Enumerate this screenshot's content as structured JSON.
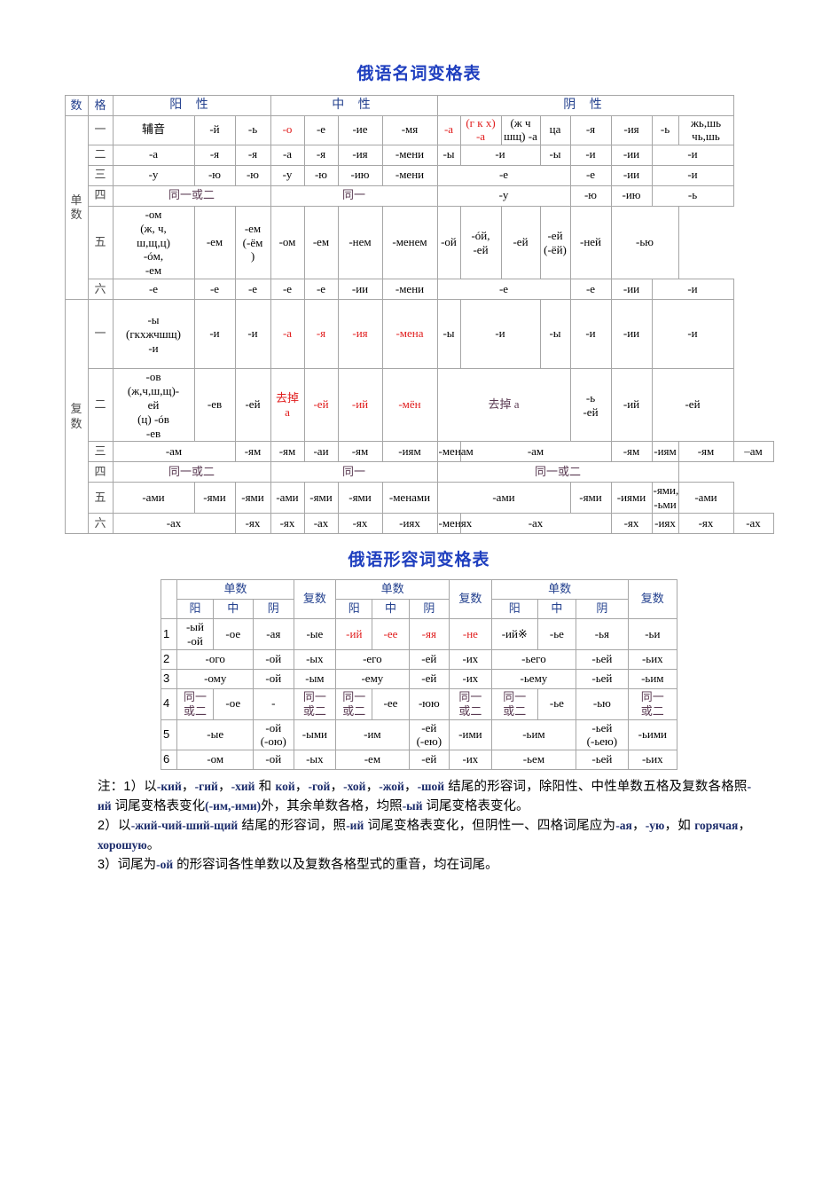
{
  "noun_table": {
    "title": "俄语名词变格表",
    "header": {
      "number_label": "数",
      "case_label": "格",
      "masculine": "阳 性",
      "neuter": "中 性",
      "feminine": "阴 性"
    },
    "number_groups": {
      "singular": [
        "单",
        "数"
      ],
      "plural": [
        "复",
        "数"
      ]
    },
    "singular_rows": [
      {
        "case": "一",
        "cells": [
          {
            "t": "辅音",
            "cn": true
          },
          {
            "t": "-й"
          },
          {
            "t": "-ь"
          },
          {
            "t": "-о",
            "red": true
          },
          {
            "t": "-е"
          },
          {
            "t": "-ие"
          },
          {
            "t": "-мя"
          },
          {
            "t": "-а",
            "red": true
          },
          {
            "t": "(г к х) -а",
            "red": true
          },
          {
            "t": "(ж ч шщ) -а"
          },
          {
            "t": "ца"
          },
          {
            "t": "-я"
          },
          {
            "t": "-ия"
          },
          {
            "t": "-ь"
          },
          {
            "t": "жь,шь чь,шь"
          }
        ]
      },
      {
        "case": "二",
        "cells": [
          {
            "t": "-а"
          },
          {
            "t": "-я"
          },
          {
            "t": "-я"
          },
          {
            "t": "-а"
          },
          {
            "t": "-я"
          },
          {
            "t": "-ия"
          },
          {
            "t": "-мени"
          },
          {
            "t": "-ы"
          },
          {
            "t": "-и",
            "span": 2
          },
          {
            "t": "-ы"
          },
          {
            "t": "-и"
          },
          {
            "t": "-ии"
          },
          {
            "t": "-и",
            "span": 2
          }
        ]
      },
      {
        "case": "三",
        "cells": [
          {
            "t": "-у"
          },
          {
            "t": "-ю"
          },
          {
            "t": "-ю"
          },
          {
            "t": "-у"
          },
          {
            "t": "-ю"
          },
          {
            "t": "-ию"
          },
          {
            "t": "-мени"
          },
          {
            "t": "-е",
            "span": 4
          },
          {
            "t": "-е"
          },
          {
            "t": "-ии"
          },
          {
            "t": "-и",
            "span": 2
          }
        ]
      },
      {
        "case": "四",
        "cells": [
          {
            "t": "同一或二",
            "span": 3,
            "same": true
          },
          {
            "t": "同一",
            "span": 4,
            "same": true
          },
          {
            "t": "-у",
            "span": 4
          },
          {
            "t": "-ю"
          },
          {
            "t": "-ию"
          },
          {
            "t": "-ь",
            "span": 2
          }
        ]
      },
      {
        "case": "五",
        "tall": true,
        "cells": [
          {
            "t": "-ом (ж, ч, ш,щ,ц) -óм, -ем",
            "lines": [
              "-ом",
              "(ж, ч,",
              "ш,щ,ц)",
              "-óм,",
              "-ем"
            ]
          },
          {
            "t": "-ем"
          },
          {
            "t": "-ем (-ём )",
            "lines": [
              "-ем",
              "(-ём",
              ")"
            ]
          },
          {
            "t": "-ом"
          },
          {
            "t": "-ем"
          },
          {
            "t": "-нем"
          },
          {
            "t": "-менем"
          },
          {
            "t": "-ой",
            "span": 1
          },
          {
            "t": "-óй, -ей",
            "lines": [
              "-óй,",
              "-ей"
            ]
          },
          {
            "t": "-ей"
          },
          {
            "t": "-ей (-ёй)",
            "lines": [
              "-ей",
              "(-ёй)"
            ]
          },
          {
            "t": "-ней"
          },
          {
            "t": "-ью",
            "span": 2
          }
        ]
      },
      {
        "case": "六",
        "cells": [
          {
            "t": "-е"
          },
          {
            "t": "-е"
          },
          {
            "t": "-е"
          },
          {
            "t": "-е"
          },
          {
            "t": "-е"
          },
          {
            "t": "-ии"
          },
          {
            "t": "-мени"
          },
          {
            "t": "-е",
            "span": 4
          },
          {
            "t": "-е"
          },
          {
            "t": "-ии"
          },
          {
            "t": "-и",
            "span": 2
          }
        ]
      }
    ],
    "plural_rows": [
      {
        "case": "一",
        "tall": true,
        "cells": [
          {
            "t": "-ы (гкхжчшщ) -и",
            "lines": [
              "-ы",
              "(гкхжчшщ)",
              "-и"
            ]
          },
          {
            "t": "-и"
          },
          {
            "t": "-и"
          },
          {
            "t": "-а",
            "red": true
          },
          {
            "t": "-я",
            "red": true
          },
          {
            "t": "-ия",
            "red": true
          },
          {
            "t": "-мена",
            "red": true
          },
          {
            "t": "-ы"
          },
          {
            "t": "-и",
            "span": 2
          },
          {
            "t": "-ы"
          },
          {
            "t": "-и"
          },
          {
            "t": "-ии"
          },
          {
            "t": "-и",
            "span": 2
          }
        ]
      },
      {
        "case": "二",
        "tall": true,
        "cells": [
          {
            "t": "-ов (ж,ч,ш,щ)-ей (ц) -óв -ев",
            "lines": [
              "-ов",
              "(ж,ч,ш,щ)-",
              "ей",
              "(ц) -óв",
              "-ев"
            ]
          },
          {
            "t": "-ев"
          },
          {
            "t": "-ей"
          },
          {
            "t": "去掉 а",
            "red": true,
            "lines": [
              "去掉",
              "а"
            ]
          },
          {
            "t": "-ей",
            "red": true
          },
          {
            "t": "-ий",
            "red": true
          },
          {
            "t": "-мён",
            "red": true
          },
          {
            "t": "去掉 а",
            "span": 4,
            "same": true
          },
          {
            "t": "-ь -ей",
            "lines": [
              "-ь",
              "-ей"
            ]
          },
          {
            "t": "-ий"
          },
          {
            "t": "-ей",
            "span": 2
          }
        ]
      },
      {
        "case": "三",
        "cells": [
          {
            "t": "-ам",
            "span": 2
          },
          {
            "t": "-ям"
          },
          {
            "t": "-ям"
          },
          {
            "t": "-аи"
          },
          {
            "t": "-ям"
          },
          {
            "t": "-иям"
          },
          {
            "t": "-менам"
          },
          {
            "t": "-ам",
            "span": 4
          },
          {
            "t": "-ям"
          },
          {
            "t": "-иям"
          },
          {
            "t": "-ям"
          },
          {
            "t": "–ам"
          }
        ]
      },
      {
        "case": "四",
        "cells": [
          {
            "t": "同一或二",
            "span": 3,
            "same": true
          },
          {
            "t": "同一",
            "span": 4,
            "same": true
          },
          {
            "t": "同一或二",
            "span": 7,
            "same": true
          }
        ]
      },
      {
        "case": "五",
        "cells": [
          {
            "t": "-ами"
          },
          {
            "t": "-ями"
          },
          {
            "t": "-ями"
          },
          {
            "t": "-ами"
          },
          {
            "t": "-ями"
          },
          {
            "t": "-ями"
          },
          {
            "t": "-менами"
          },
          {
            "t": "-ами",
            "span": 4
          },
          {
            "t": "-ями"
          },
          {
            "t": "-иями"
          },
          {
            "t": "-ями, -ьми",
            "lines": [
              "-ями,",
              "-ьми"
            ]
          },
          {
            "t": "-ами"
          }
        ]
      },
      {
        "case": "六",
        "cells": [
          {
            "t": "-ах",
            "span": 2
          },
          {
            "t": "-ях"
          },
          {
            "t": "-ях"
          },
          {
            "t": "-ах"
          },
          {
            "t": "-ях"
          },
          {
            "t": "-иях"
          },
          {
            "t": "-менях"
          },
          {
            "t": "-ах",
            "span": 4
          },
          {
            "t": "-ях"
          },
          {
            "t": "-иях"
          },
          {
            "t": "-ях"
          },
          {
            "t": "-ах"
          }
        ]
      }
    ]
  },
  "adj_table": {
    "title": "俄语形容词变格表",
    "header": {
      "singular": "单数",
      "plural": "复数",
      "masc": "阳",
      "neut": "中",
      "fem": "阴"
    },
    "rows": [
      {
        "no": "1",
        "cells": [
          {
            "t": "-ый -ой",
            "lines": [
              "-ый",
              "-ой"
            ]
          },
          {
            "t": "-ое"
          },
          {
            "t": "-ая"
          },
          {
            "t": "-ые"
          },
          {
            "t": "-ий",
            "red": true
          },
          {
            "t": "-ее",
            "red": true
          },
          {
            "t": "-яя",
            "red": true
          },
          {
            "t": "-не",
            "red": true
          },
          {
            "t": "-ий※"
          },
          {
            "t": "-ье"
          },
          {
            "t": "-ья"
          },
          {
            "t": "-ьи"
          }
        ]
      },
      {
        "no": "2",
        "cells": [
          {
            "t": "-ого",
            "span": 2
          },
          {
            "t": "-ой"
          },
          {
            "t": "-ых"
          },
          {
            "t": "-его",
            "span": 2
          },
          {
            "t": "-ей"
          },
          {
            "t": "-их"
          },
          {
            "t": "-ьего",
            "span": 2
          },
          {
            "t": "-ьей"
          },
          {
            "t": "-ьих"
          }
        ]
      },
      {
        "no": "3",
        "cells": [
          {
            "t": "-ому",
            "span": 2
          },
          {
            "t": "-ой"
          },
          {
            "t": "-ым"
          },
          {
            "t": "-ему",
            "span": 2
          },
          {
            "t": "-ей"
          },
          {
            "t": "-их"
          },
          {
            "t": "-ьему",
            "span": 2
          },
          {
            "t": "-ьей"
          },
          {
            "t": "-ьим"
          }
        ]
      },
      {
        "no": "4",
        "cells": [
          {
            "t": "同一或二",
            "same": true,
            "lines": [
              "同一",
              "或二"
            ]
          },
          {
            "t": "-ое"
          },
          {
            "t": "-"
          },
          {
            "t": "同一或二",
            "same": true,
            "lines": [
              "同一",
              "或二"
            ]
          },
          {
            "t": "同一或二",
            "same": true,
            "lines": [
              "同一",
              "或二"
            ]
          },
          {
            "t": "-ее"
          },
          {
            "t": "-юю"
          },
          {
            "t": "同一或二",
            "same": true,
            "lines": [
              "同一",
              "或二"
            ]
          },
          {
            "t": "同一或二",
            "same": true,
            "lines": [
              "同一",
              "或二"
            ]
          },
          {
            "t": "-ье"
          },
          {
            "t": "-ью"
          },
          {
            "t": "同一或二",
            "same": true,
            "lines": [
              "同一",
              "或二"
            ]
          }
        ]
      },
      {
        "no": "5",
        "cells": [
          {
            "t": "-ые",
            "span": 2
          },
          {
            "t": "-ой (-ою)",
            "lines": [
              "-ой",
              "(-ою)"
            ]
          },
          {
            "t": "-ыми"
          },
          {
            "t": "-им",
            "span": 2
          },
          {
            "t": "-ей (-ею)",
            "lines": [
              "-ей",
              "(-ею)"
            ]
          },
          {
            "t": "-ими"
          },
          {
            "t": "-ьим",
            "span": 2
          },
          {
            "t": "-ьей (-ьею)",
            "lines": [
              "-ьей",
              "(-ьею)"
            ]
          },
          {
            "t": "-ьими"
          }
        ]
      },
      {
        "no": "6",
        "cells": [
          {
            "t": "-ом",
            "span": 2
          },
          {
            "t": "-ой"
          },
          {
            "t": "-ых"
          },
          {
            "t": "-ем",
            "span": 2
          },
          {
            "t": "-ей"
          },
          {
            "t": "-их"
          },
          {
            "t": "-ьем",
            "span": 2
          },
          {
            "t": "-ьей"
          },
          {
            "t": "-ьих"
          }
        ]
      }
    ]
  },
  "notes": {
    "line1": "注：1）以-кий，-гий，-хий 和 кой，-гой，-хой，-жой，-шой 结尾的形容词，除阳性、中性单数五格及复数各格照-ий 词尾变格表变化(-им,-ими)外，其余单数各格，均照-ый 词尾变格表变化。",
    "line2": "2）以-жий-чий-ший-щий 结尾的形容词，照-ий 词尾变格表变化，但阴性一、四格词尾应为-ая，-ую，如 горячая，хорошую。",
    "line3": "3）词尾为-ой 的形容词各性单数以及复数各格型式的重音，均在词尾。"
  }
}
